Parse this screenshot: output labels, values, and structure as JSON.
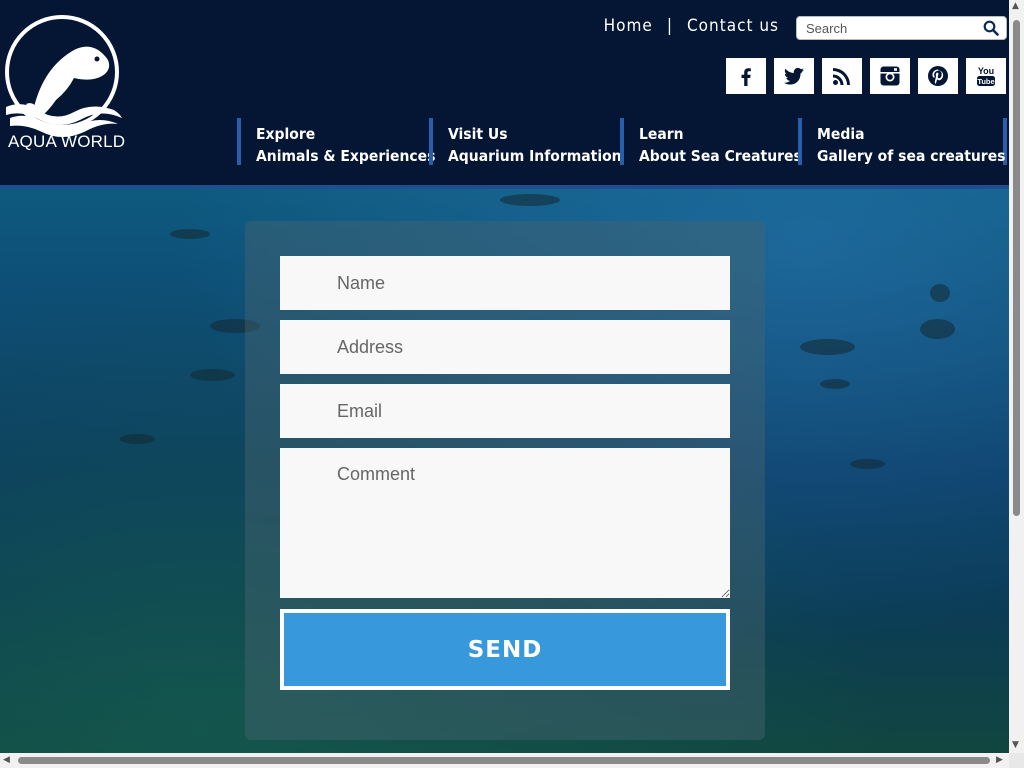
{
  "brand": {
    "name": "AQUA WORLD"
  },
  "toplinks": {
    "home": "Home",
    "separator": "|",
    "contact": "Contact us"
  },
  "search": {
    "placeholder": "Search",
    "icon": "search-icon"
  },
  "social": [
    {
      "name": "facebook",
      "icon": "facebook-icon"
    },
    {
      "name": "twitter",
      "icon": "twitter-icon"
    },
    {
      "name": "rss",
      "icon": "rss-icon"
    },
    {
      "name": "instagram",
      "icon": "instagram-icon"
    },
    {
      "name": "pinterest",
      "icon": "pinterest-icon"
    },
    {
      "name": "youtube",
      "icon": "youtube-icon",
      "label_top": "You",
      "label_bottom": "Tube"
    }
  ],
  "nav": [
    {
      "title": "Explore",
      "subtitle": "Animals & Experiences"
    },
    {
      "title": "Visit Us",
      "subtitle": "Aquarium Information"
    },
    {
      "title": "Learn",
      "subtitle": "About Sea Creatures"
    },
    {
      "title": "Media",
      "subtitle": "Gallery of sea creatures"
    }
  ],
  "form": {
    "name_placeholder": "Name",
    "address_placeholder": "Address",
    "email_placeholder": "Email",
    "comment_placeholder": "Comment",
    "send_label": "SEND"
  },
  "colors": {
    "header_bg": "#041633",
    "nav_accent": "#2a5ea8",
    "send_button": "#3898dc"
  }
}
